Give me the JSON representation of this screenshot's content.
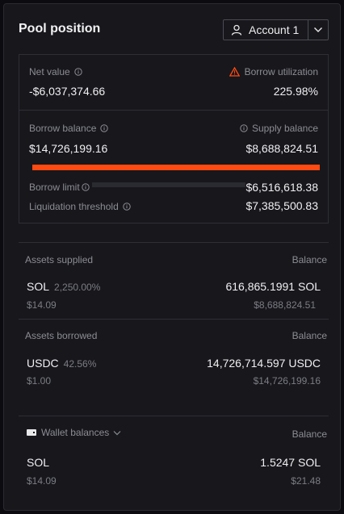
{
  "header": {
    "title": "Pool position",
    "account_label": "Account 1"
  },
  "summary": {
    "net_value_label": "Net value",
    "net_value": "-$6,037,374.66",
    "borrow_util_label": "Borrow utilization",
    "borrow_util": "225.98%",
    "borrow_balance_label": "Borrow balance",
    "borrow_balance": "$14,726,199.16",
    "supply_balance_label": "Supply balance",
    "supply_balance": "$8,688,824.51",
    "borrow_limit_label": "Borrow limit",
    "borrow_limit": "$6,516,618.38",
    "liq_threshold_label": "Liquidation threshold",
    "liq_threshold": "$7,385,500.83",
    "utilization_fraction": 1.0,
    "bar_color": "#ff4a12",
    "warning_color": "#ff4a12"
  },
  "supplied": {
    "header": "Assets supplied",
    "balance_header": "Balance",
    "rows": [
      {
        "symbol": "SOL",
        "percent": "2,250.00%",
        "price": "$14.09",
        "amount": "616,865.1991 SOL",
        "usd": "$8,688,824.51"
      }
    ]
  },
  "borrowed": {
    "header": "Assets borrowed",
    "balance_header": "Balance",
    "rows": [
      {
        "symbol": "USDC",
        "percent": "42.56%",
        "price": "$1.00",
        "amount": "14,726,714.597 USDC",
        "usd": "$14,726,199.16"
      }
    ]
  },
  "wallet": {
    "header": "Wallet balances",
    "balance_header": "Balance",
    "rows": [
      {
        "symbol": "SOL",
        "price": "$14.09",
        "amount": "1.5247 SOL",
        "usd": "$21.48"
      }
    ]
  }
}
